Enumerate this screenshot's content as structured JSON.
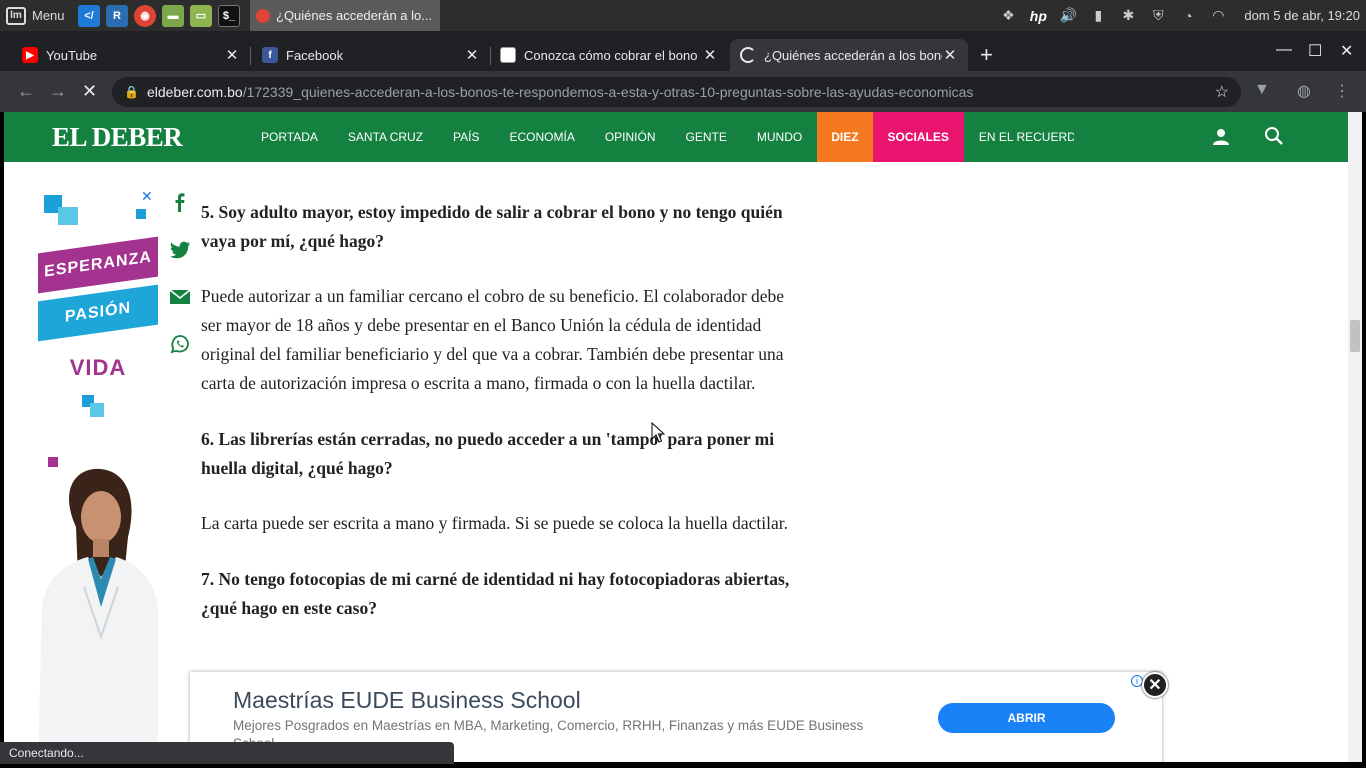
{
  "panel": {
    "menu_label": "Menu",
    "task_title": "¿Quiénes accederán a lo...",
    "clock": "dom  5 de abr, 19:20"
  },
  "tabs": [
    {
      "title": "YouTube",
      "icon": "youtube-icon"
    },
    {
      "title": "Facebook",
      "icon": "facebook-icon"
    },
    {
      "title": "Conozca cómo cobrar el bono",
      "icon": "page-icon"
    },
    {
      "title": "¿Quiénes accederán a los bono",
      "icon": "loading-icon"
    }
  ],
  "address": {
    "domain": "eldeber.com.bo",
    "path": "/172339_quienes-accederan-a-los-bonos-te-respondemos-a-esta-y-otras-10-preguntas-sobre-las-ayudas-economicas"
  },
  "site": {
    "logo": "EL DEBER",
    "nav": [
      "PORTADA",
      "SANTA CRUZ",
      "PAÍS",
      "ECONOMÍA",
      "OPINIÓN",
      "GENTE",
      "MUNDO"
    ],
    "nav_diez": "DIEZ",
    "nav_sociales": "SOCIALES",
    "nav_recuerdo": "EN EL RECUERDO",
    "colors": {
      "nav_bg": "#158141",
      "diez": "#f47920",
      "sociales": "#e8146d"
    }
  },
  "ad_left": {
    "word1": "ESPERANZA",
    "word2": "PASIÓN",
    "word3": "VIDA"
  },
  "article": {
    "q5": "5. Soy adulto mayor, estoy impedido de salir a cobrar el bono y no tengo quién vaya por mí, ¿qué hago?",
    "a5": "Puede autorizar a un familiar cercano el cobro de su beneficio. El colaborador debe ser mayor de 18 años y debe presentar en el Banco Unión la cédula de identidad original del familiar beneficiario y del que va a cobrar. También debe presentar una carta de autorización impresa o escrita a mano, firmada o con la huella dactilar.",
    "q6": "6. Las librerías están cerradas, no puedo acceder a un 'tampo' para poner mi huella digital, ¿qué hago?",
    "a6": "La carta puede ser escrita a mano y firmada. Si se puede se coloca la huella dactilar.",
    "q7": "7. No tengo fotocopias de mi carné de identidad ni hay fotocopiadoras abiertas, ¿qué hago en este caso?"
  },
  "ad_bottom": {
    "title": "Maestrías EUDE Business School",
    "desc": "Mejores Posgrados en Maestrías en MBA, Marketing, Comercio, RRHH, Finanzas y más EUDE Business School",
    "button": "ABRIR"
  },
  "status": "Conectando..."
}
